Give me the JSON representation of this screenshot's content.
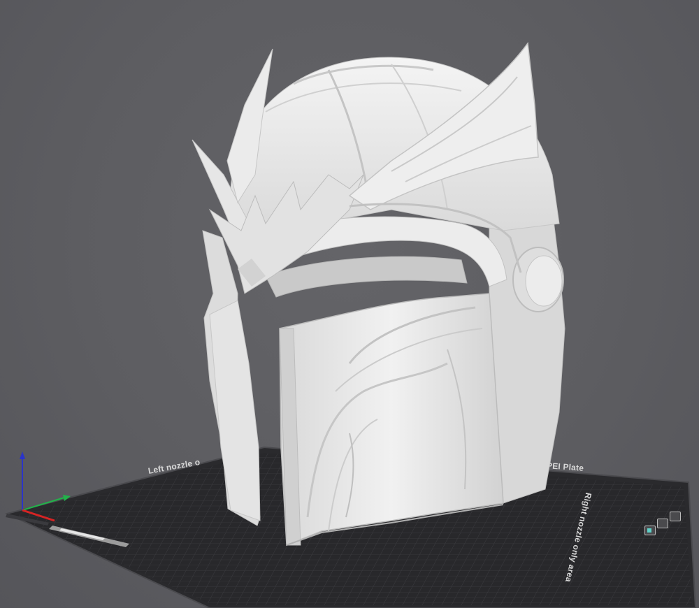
{
  "bed": {
    "left_zone_label": "Left nozzle o",
    "brand_label": "PEI Plate",
    "right_zone_label": "Right nozzle only area"
  },
  "colors": {
    "background": "#5c5c60",
    "bed_surface": "#27272a",
    "grid_line": "#3b3b3f",
    "model": "#e7e7e7",
    "axis_x": "#d62424",
    "axis_y": "#22b24a",
    "axis_z": "#2b34c8"
  },
  "icons": [
    "axis-gizmo-icon",
    "nozzle-indicator-icon"
  ]
}
